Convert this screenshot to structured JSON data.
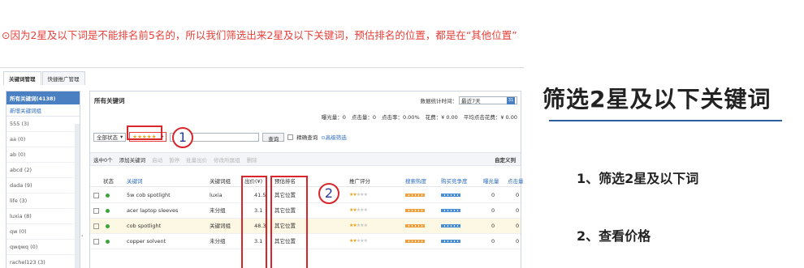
{
  "note": "⊙因为2星及以下词是不能排名前5名的，所以我们筛选出来2星及以下关键词，预估排名的位置，都是在“其他位置”",
  "tabs": [
    "关键词管理",
    "快捷推广管理"
  ],
  "sidebar": {
    "header": "所有关键词(4138)",
    "new_group": "新增关键词组",
    "items": [
      "555 (3)",
      "aa (0)",
      "ab (0)",
      "abcd (2)",
      "dada (9)",
      "life (3)",
      "luxia (8)",
      "qw (0)",
      "qwqwq (0)",
      "rachel123 (3)"
    ],
    "collapse": "‹"
  },
  "main": {
    "title": "所有关键词",
    "stats_range_label": "数据统计时间：",
    "stats_range_value": "最近7天",
    "calendar_icon": "31",
    "stats": [
      "曝光量：0",
      "点击量：0",
      "点击率：0.00%",
      "花费：¥ 0.00",
      "平均点击花费：¥ 0.00"
    ]
  },
  "filters": {
    "status": "全部状态",
    "star_filter": "★★★★★",
    "query_button": "查询",
    "exact_query": "精确查询",
    "advanced": "⊙高级筛选"
  },
  "toolbar": {
    "selected": "选中0个",
    "add_keyword": "添加关键词",
    "enable": "启动",
    "pause": "暂停",
    "batch_bid": "批量出价",
    "edit_group": "修改所属组",
    "delete": "删除",
    "customize": "自定义列"
  },
  "table": {
    "headers": [
      "状态",
      "关键词",
      "关键词组",
      "出价(¥)",
      "预估排名",
      "推广评分",
      "搜索热度",
      "购买竞争度",
      "曝光量",
      "点击量"
    ],
    "rows": [
      {
        "keyword": "5w cob spotlight",
        "group": "luxia",
        "bid": "41.5",
        "rank": "其它位置",
        "stars": 2,
        "exposure": "0",
        "clicks": "0"
      },
      {
        "keyword": "acer laptop sleeves",
        "group": "未分组",
        "bid": "3.1",
        "rank": "其它位置",
        "stars": 2,
        "exposure": "0",
        "clicks": "0"
      },
      {
        "keyword": "cob spotlight",
        "group": "关键词组",
        "bid": "48.3",
        "rank": "其它位置",
        "stars": 2,
        "exposure": "0",
        "clicks": "0"
      },
      {
        "keyword": "copper solvent",
        "group": "未分组",
        "bid": "3.1",
        "rank": "其它位置",
        "stars": 2,
        "exposure": "0",
        "clicks": "0"
      }
    ]
  },
  "annotations": {
    "circle1": "1",
    "circle2": "2"
  },
  "right_panel": {
    "title": "筛选2星及以下关键词",
    "step1": "1、筛选2星及以下词",
    "step2": "2、查看价格"
  },
  "colors": {
    "accent_red": "#d8262b",
    "note_red": "#e8403a",
    "brand_blue": "#4a7fc1",
    "star_gold": "#e9a31b"
  }
}
